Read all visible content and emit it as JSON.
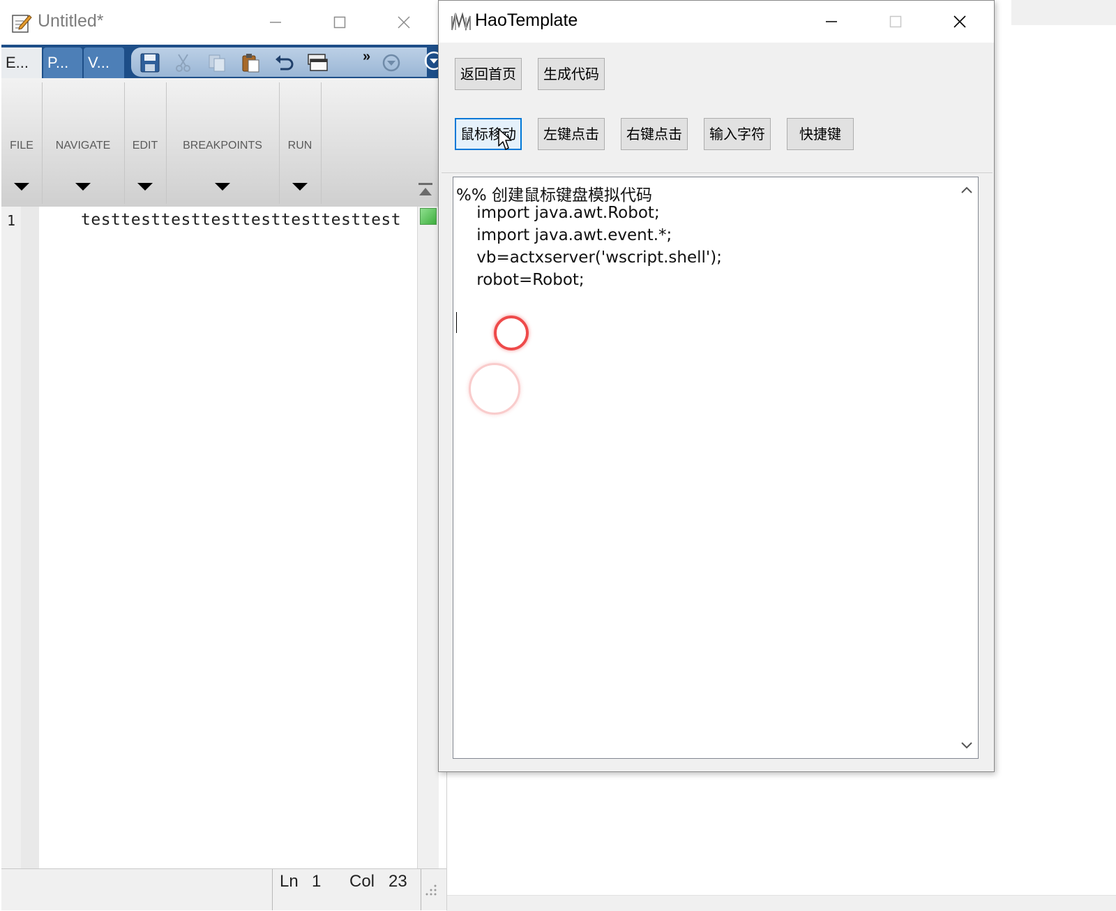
{
  "editor_window": {
    "title": "Untitled*",
    "tabs": [
      "E...",
      "P...",
      "V..."
    ],
    "overflow_label": "»",
    "ribbon_groups": [
      "FILE",
      "NAVIGATE",
      "EDIT",
      "BREAKPOINTS",
      "RUN"
    ],
    "line_number": "1",
    "code_line": "testtesttesttesttesttesttesttest",
    "status": {
      "ln_label": "Ln",
      "ln_value": "1",
      "col_label": "Col",
      "col_value": "23"
    }
  },
  "template_window": {
    "title": "HaoTemplate",
    "buttons_row1": [
      "返回首页",
      "生成代码"
    ],
    "buttons_row2": [
      "鼠标移动",
      "左键点击",
      "右键点击",
      "输入字符",
      "快捷键"
    ],
    "focused_button": "鼠标移动",
    "code_lines": [
      "%% 创建鼠标键盘模拟代码",
      "    import java.awt.Robot;",
      "    import java.awt.event.*;",
      "    vb=actxserver('wscript.shell');",
      "    robot=Robot;"
    ]
  },
  "colors": {
    "ribbon_tab_bar": "#1d4e88",
    "focus_border": "#0078d7",
    "click_indicator": "#ee4a4a"
  }
}
